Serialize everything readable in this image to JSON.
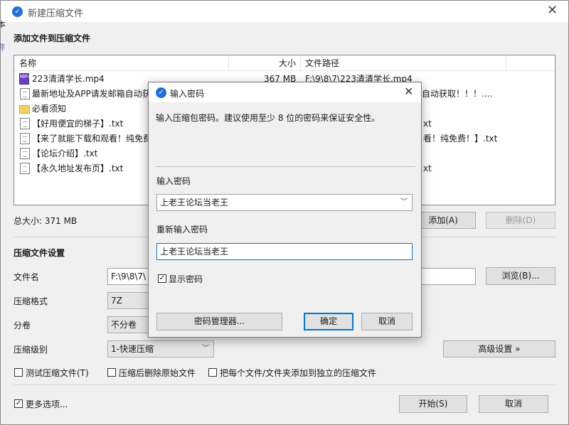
{
  "window": {
    "title": "新建压缩文件",
    "add_files_heading": "添加文件到压缩文件",
    "total_size": "总大小: 371 MB",
    "add_button": "添加(A)",
    "delete_button": "删除(D)",
    "settings_heading": "压缩文件设置",
    "filename_label": "文件名",
    "filename_value": "F:\\9\\8\\7\\",
    "browse_button": "浏览(B)...",
    "format_label": "压缩格式",
    "format_value": "7Z",
    "split_label": "分卷",
    "split_value": "不分卷",
    "level_label": "压缩级别",
    "level_value": "1-快速压缩",
    "advanced_button": "高级设置 »",
    "test_checkbox": "测试压缩文件(T)",
    "delete_after_checkbox": "压缩后删除原始文件",
    "separate_checkbox": "把每个文件/文件夹添加到独立的压缩文件",
    "more_options_checkbox": "更多选项...",
    "more_options_checked": "✓",
    "start_button": "开始(S)",
    "cancel_button": "取消",
    "edge_clip_1": "本",
    "edge_clip_2": "称"
  },
  "file_list": {
    "columns": {
      "name": "名称",
      "size": "大小",
      "path": "文件路径"
    },
    "rows": [
      {
        "name": "223清清学长.mp4",
        "size": "367 MB",
        "path": "F:\\9\\8\\7\\223清清学长.mp4",
        "icon": "video-file-icon"
      },
      {
        "name": "最新地址及APP请发邮箱自动获",
        "path": "箱自动获取！！！....",
        "icon": "text-file-icon"
      },
      {
        "name": "必看须知",
        "icon": "folder-icon"
      },
      {
        "name": "【好用便宜的梯子】.txt",
        "path": "xt",
        "icon": "text-file-icon"
      },
      {
        "name": "【来了就能下载和观看！纯免费",
        "path": "看！纯免费！】.txt",
        "icon": "text-file-icon"
      },
      {
        "name": "【论坛介绍】.txt",
        "icon": "text-file-icon"
      },
      {
        "name": "【永久地址发布页】.txt",
        "path": "xt",
        "icon": "text-file-icon"
      }
    ],
    "video_icon_text": "MP4"
  },
  "dialog": {
    "title": "输入密码",
    "description": "输入压缩包密码。建议使用至少 8 位的密码来保证安全性。",
    "password_label": "输入密码",
    "password_value": "上老王论坛当老王",
    "reenter_label": "重新输入密码",
    "reenter_value": "上老王论坛当老王",
    "show_password_label": "显示密码",
    "show_password_checked": "✓",
    "manager_button": "密码管理器...",
    "ok_button": "确定",
    "cancel_button": "取消"
  },
  "icons": {
    "logo": "app-logo-icon",
    "close": "close-icon",
    "chevron": "chevron-down-icon"
  },
  "colors": {
    "accent": "#1e6fd9",
    "window_bg": "#f0f0f0",
    "focus_border": "#0078d7"
  }
}
